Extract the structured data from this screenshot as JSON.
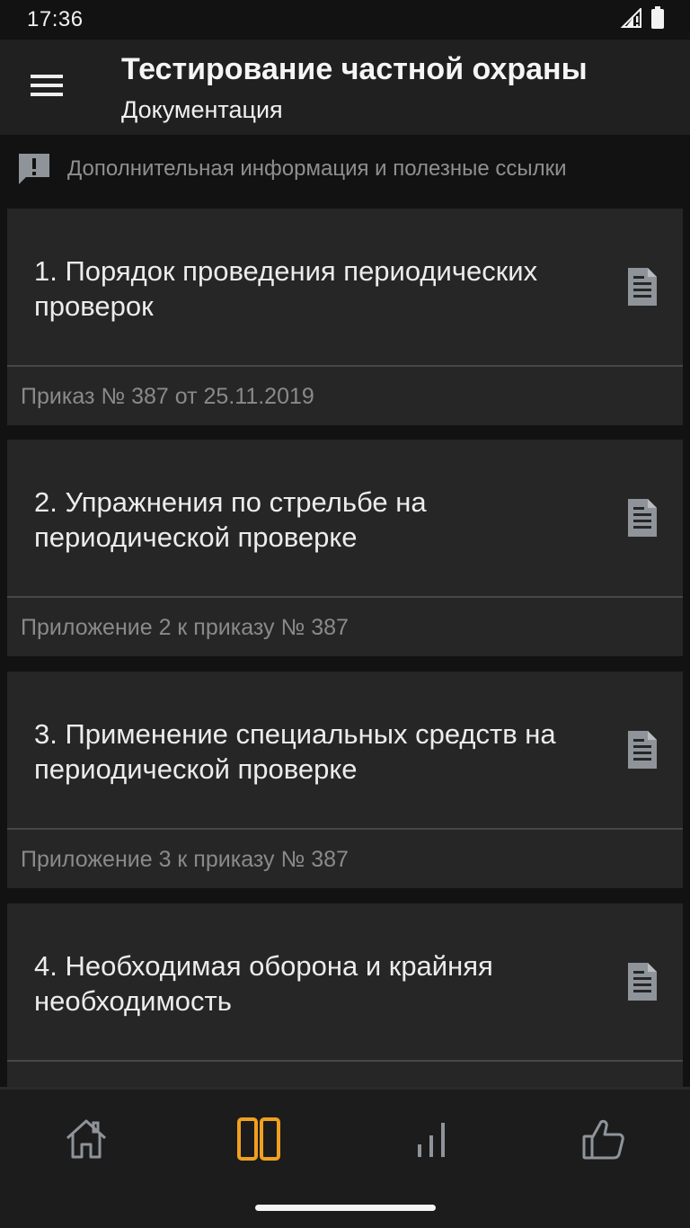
{
  "status_bar": {
    "time": "17:36",
    "icons": [
      "signal-icon",
      "battery-icon"
    ]
  },
  "app_bar": {
    "title": "Тестирование частной охраны",
    "subtitle": "Документация",
    "menu_icon": "menu-icon"
  },
  "info": {
    "icon": "feedback-icon",
    "text": "Дополнительная информация и полезные ссылки"
  },
  "cards": [
    {
      "title": "1. Порядок проведения периодических проверок",
      "subtitle": "Приказ № 387 от 25.11.2019",
      "icon": "document-icon"
    },
    {
      "title": "2. Упражнения по стрельбе на периодической проверке",
      "subtitle": "Приложение 2 к приказу № 387",
      "icon": "document-icon"
    },
    {
      "title": "3. Применение специальных средств на периодической проверке",
      "subtitle": "Приложение 3 к приказу № 387",
      "icon": "document-icon"
    },
    {
      "title": "4. Необходимая оборона и крайняя необходимость",
      "subtitle": "",
      "icon": "document-icon"
    }
  ],
  "bottom_nav": {
    "items": [
      {
        "icon": "home-icon",
        "active": false
      },
      {
        "icon": "book-icon",
        "active": true
      },
      {
        "icon": "stats-icon",
        "active": false
      },
      {
        "icon": "thumbs-up-icon",
        "active": false
      }
    ]
  },
  "colors": {
    "background": "#121212",
    "app_bar": "#202020",
    "card": "#262626",
    "accent": "#f0a020",
    "icon_muted": "#8e949a"
  }
}
